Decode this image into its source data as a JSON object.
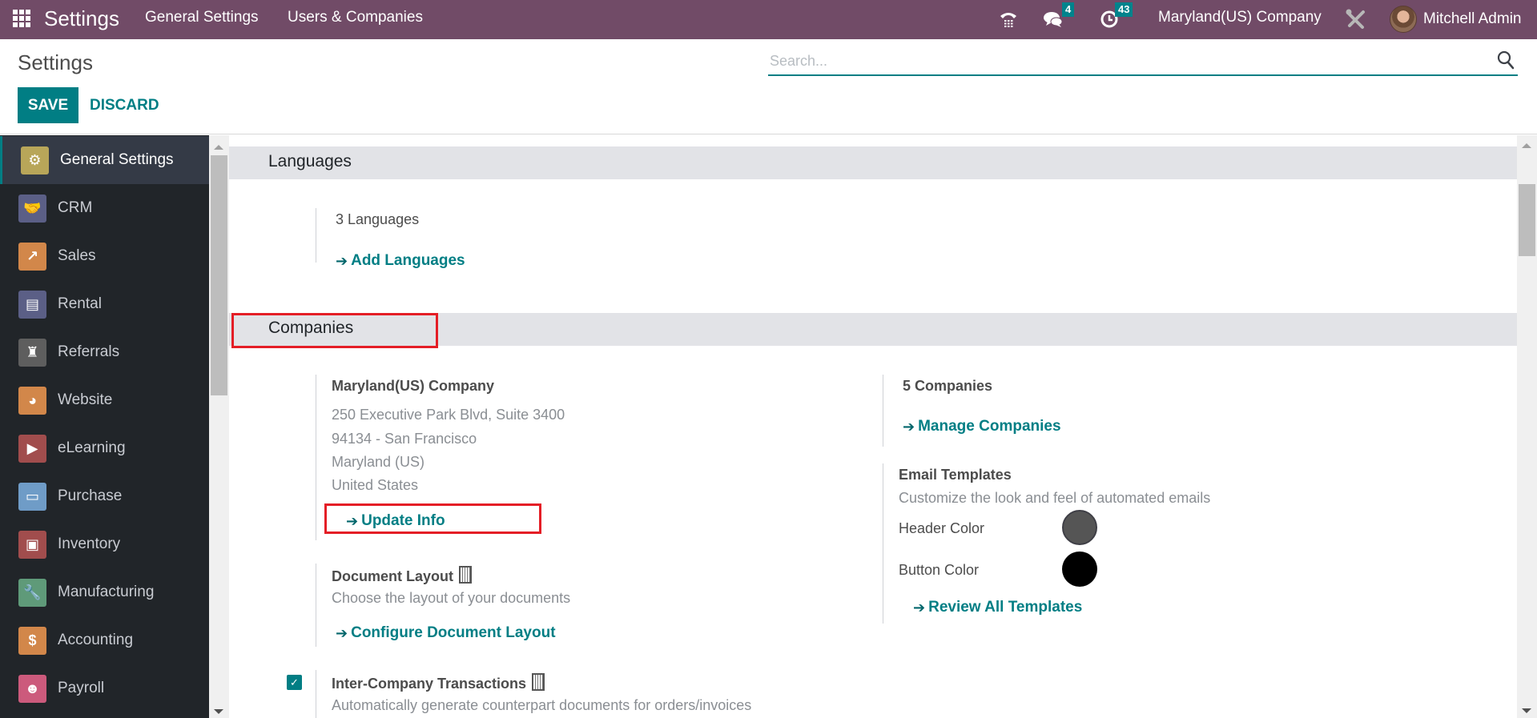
{
  "navbar": {
    "app_title": "Settings",
    "menu": [
      "General Settings",
      "Users & Companies"
    ],
    "messages_count": "4",
    "activities_count": "43",
    "company": "Maryland(US) Company",
    "user": "Mitchell Admin",
    "icons": [
      "apps-grid-icon",
      "phone-icon",
      "chat-icon",
      "clock-icon",
      "debug-tools-icon",
      "user-avatar"
    ]
  },
  "control_panel": {
    "title": "Settings",
    "save_label": "SAVE",
    "discard_label": "DISCARD",
    "search_placeholder": "Search...",
    "search_value": ""
  },
  "sidebar": {
    "items": [
      {
        "label": "General Settings",
        "icon": "gear-icon",
        "color": "#b8a659",
        "active": true
      },
      {
        "label": "CRM",
        "icon": "handshake-icon",
        "color": "#5b5f86"
      },
      {
        "label": "Sales",
        "icon": "chart-up-icon",
        "color": "#d2874a"
      },
      {
        "label": "Rental",
        "icon": "calendar-grid-icon",
        "color": "#5b5f86"
      },
      {
        "label": "Referrals",
        "icon": "referral-person-icon",
        "color": "#5e5e5e"
      },
      {
        "label": "Website",
        "icon": "globe-icon",
        "color": "#d2874a"
      },
      {
        "label": "eLearning",
        "icon": "elearning-icon",
        "color": "#a14d4d"
      },
      {
        "label": "Purchase",
        "icon": "credit-card-icon",
        "color": "#6f9cc7"
      },
      {
        "label": "Inventory",
        "icon": "box-icon",
        "color": "#a14d4d"
      },
      {
        "label": "Manufacturing",
        "icon": "wrench-icon",
        "color": "#5f9a79"
      },
      {
        "label": "Accounting",
        "icon": "invoice-dollar-icon",
        "color": "#d2874a"
      },
      {
        "label": "Payroll",
        "icon": "payroll-icon",
        "color": "#cc5a7c"
      }
    ]
  },
  "main": {
    "languages": {
      "title": "Languages",
      "count_label": "3 Languages",
      "add_link": "Add Languages"
    },
    "companies": {
      "title": "Companies",
      "company_name": "Maryland(US) Company",
      "address_lines": [
        "250 Executive Park Blvd, Suite 3400",
        "94134 - San Francisco",
        "Maryland (US)",
        "United States"
      ],
      "update_link": "Update Info",
      "count_label": "5 Companies",
      "manage_link": "Manage Companies",
      "email_templates": {
        "title": "Email Templates",
        "description": "Customize the look and feel of automated emails",
        "header_color_label": "Header Color",
        "header_color": "#555555",
        "button_color_label": "Button Color",
        "button_color": "#000000",
        "review_link": "Review All Templates"
      },
      "document_layout": {
        "title": "Document Layout",
        "description": "Choose the layout of your documents",
        "configure_link": "Configure Document Layout"
      },
      "inter_company": {
        "title": "Inter-Company Transactions",
        "description": "Automatically generate counterpart documents for orders/invoices",
        "checked": true,
        "check_glyph": "✓"
      }
    }
  },
  "colors": {
    "navbar": "#714B67",
    "primary": "#017e84",
    "highlight": "#e41e26"
  },
  "glyphs": {
    "arrow": "➔",
    "sidebar_glyphs": [
      "⚙",
      "🤝",
      "↗",
      "▤",
      "♜",
      "◕",
      "▶",
      "▭",
      "▣",
      "🔧",
      "$",
      "☻"
    ]
  }
}
